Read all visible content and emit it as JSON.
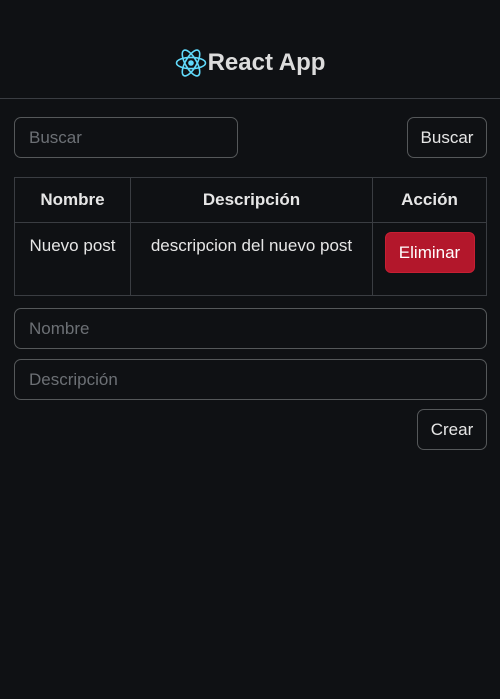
{
  "header": {
    "logo_icon": "react-atom-icon",
    "title": "React App",
    "accent": "#61dafb"
  },
  "search": {
    "placeholder": "Buscar",
    "value": "",
    "button_label": "Buscar"
  },
  "table": {
    "columns": [
      "Nombre",
      "Descripción",
      "Acción"
    ],
    "rows": [
      {
        "nombre": "Nuevo post",
        "descripcion": "descripcion del nuevo post",
        "action_label": "Eliminar"
      }
    ]
  },
  "form": {
    "nombre_placeholder": "Nombre",
    "descripcion_placeholder": "Descripción",
    "create_label": "Crear"
  },
  "colors": {
    "background": "#0f1114",
    "border": "#55585a",
    "danger": "#b3172b"
  }
}
